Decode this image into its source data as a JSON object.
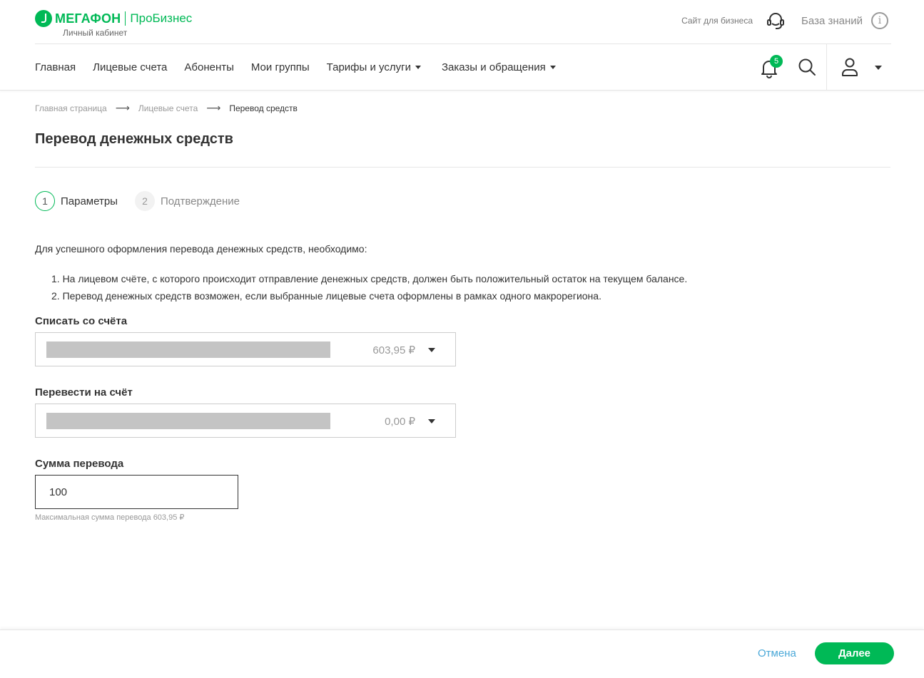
{
  "header": {
    "brand": "МЕГАФОН",
    "brand_sub": "ПроБизнес",
    "cabinet": "Личный кабинет",
    "business_site": "Сайт для бизнеса",
    "knowledge_base": "База знаний",
    "info_glyph": "i",
    "icons": [
      "support-headset-icon",
      "info-icon"
    ]
  },
  "nav": {
    "items": [
      {
        "label": "Главная",
        "dropdown": false
      },
      {
        "label": "Лицевые счета",
        "dropdown": false
      },
      {
        "label": "Абоненты",
        "dropdown": false
      },
      {
        "label": "Мои группы",
        "dropdown": false
      },
      {
        "label": "Тарифы и услуги",
        "dropdown": true
      },
      {
        "label": "Заказы и обращения",
        "dropdown": true
      }
    ],
    "notifications_count": "5",
    "icons": [
      "bell-icon",
      "search-icon",
      "user-icon",
      "chevron-down-icon"
    ]
  },
  "breadcrumb": {
    "items": [
      "Главная страница",
      "Лицевые счета",
      "Перевод средств"
    ],
    "separator": "⟶"
  },
  "page": {
    "title": "Перевод денежных средств",
    "steps": [
      {
        "number": "1",
        "label": "Параметры",
        "active": true
      },
      {
        "number": "2",
        "label": "Подтверждение",
        "active": false
      }
    ],
    "intro": "Для успешного оформления перевода денежных средств, необходимо:",
    "rules": [
      "1. На лицевом счёте, с которого происходит отправление денежных средств, должен быть положительный остаток на текущем балансе.",
      "2. Перевод денежных средств возможен, если выбранные лицевые счета оформлены в рамках одного макрорегиона."
    ]
  },
  "form": {
    "from_label": "Списать со счёта",
    "from_amount": "603,95 ₽",
    "to_label": "Перевести на счёт",
    "to_amount": "0,00 ₽",
    "sum_label": "Сумма перевода",
    "sum_value": "100",
    "sum_hint": "Максимальная сумма перевода 603,95 ₽"
  },
  "footer": {
    "cancel_label": "Отмена",
    "next_label": "Далее"
  },
  "colors": {
    "brand_green": "#00b956",
    "link_blue": "#4aa8d8",
    "mask_gray": "#c4c4c4"
  }
}
